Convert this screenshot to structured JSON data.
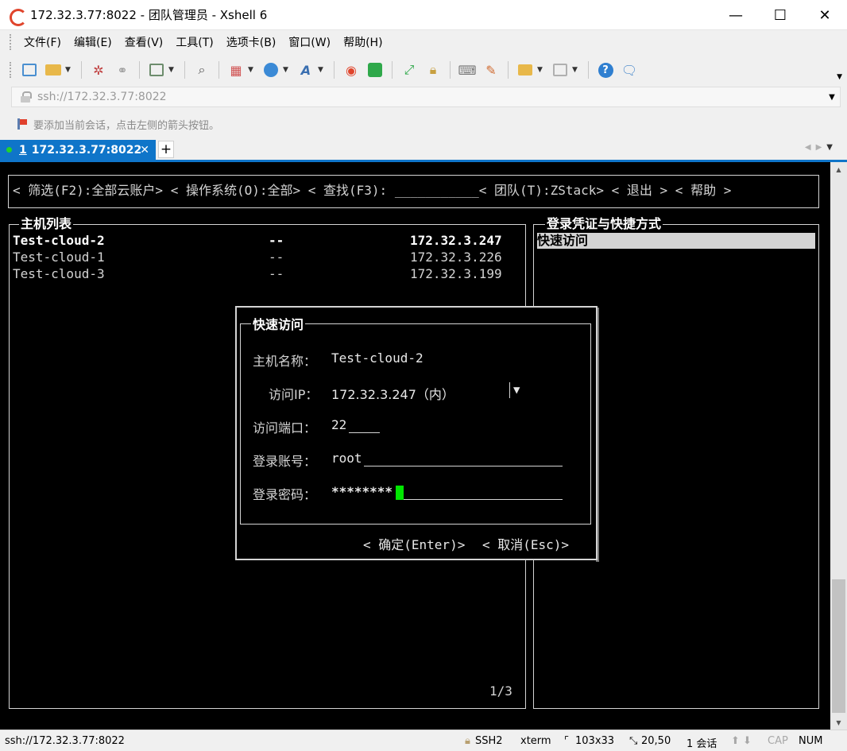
{
  "window": {
    "title": "172.32.3.77:8022 - 团队管理员 - Xshell 6",
    "minimize": "—",
    "maximize": "☐",
    "close": "✕"
  },
  "menu": [
    "文件(F)",
    "编辑(E)",
    "查看(V)",
    "工具(T)",
    "选项卡(B)",
    "窗口(W)",
    "帮助(H)"
  ],
  "address": {
    "value": "ssh://172.32.3.77:8022"
  },
  "hint": {
    "text": "要添加当前会话，点击左侧的箭头按钮。"
  },
  "tab": {
    "index": "1",
    "label": "172.32.3.77:8022",
    "close": "✕",
    "add": "+"
  },
  "terminal": {
    "topbar": "< 筛选(F2):全部云账户> < 操作系统(O):全部> < 查找(F3): ___________< 团队(T):ZStack> < 退出 > < 帮助 >",
    "host_list": {
      "title": "主机列表",
      "rows": [
        {
          "name": "Test-cloud-2",
          "os": "--",
          "ip": "172.32.3.247",
          "selected": true
        },
        {
          "name": "Test-cloud-1",
          "os": "--",
          "ip": "172.32.3.226",
          "selected": false
        },
        {
          "name": "Test-cloud-3",
          "os": "--",
          "ip": "172.32.3.199",
          "selected": false
        }
      ],
      "pager": "1/3"
    },
    "credentials": {
      "title": "登录凭证与快捷方式",
      "items": [
        "快速访问"
      ]
    },
    "dialog": {
      "title": "快速访问",
      "host_label": "主机名称：",
      "host_value": "Test-cloud-2",
      "ip_label": "访问IP：",
      "ip_value": "172.32.3.247（内）",
      "ip_dropdown": "▼",
      "port_label": "访问端口：",
      "port_value": "22",
      "user_label": "登录账号：",
      "user_value": "root",
      "pass_label": "登录密码：",
      "pass_value": "********",
      "ok": "< 确定(Enter)>",
      "cancel": "< 取消(Esc)>"
    }
  },
  "status": {
    "connection": "ssh://172.32.3.77:8022",
    "protocol": "SSH2",
    "term": "xterm",
    "size": "103x33",
    "cursor": "20,50",
    "sessions": "1 会话",
    "cap": "CAP",
    "num": "NUM"
  }
}
